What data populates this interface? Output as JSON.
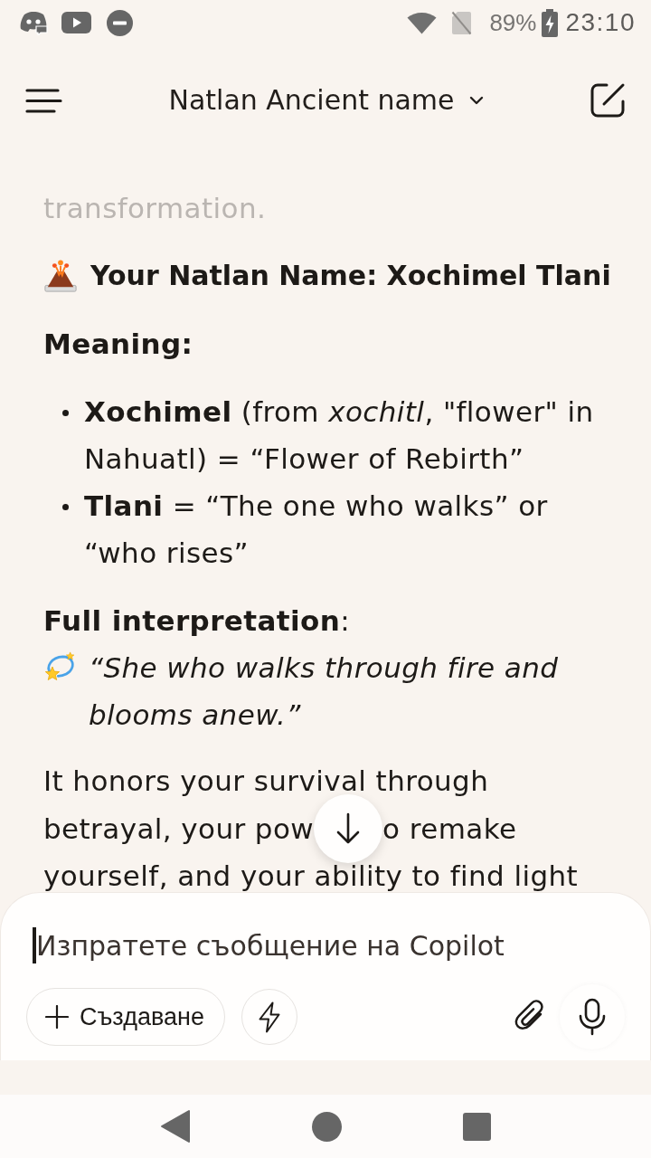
{
  "status_bar": {
    "battery": "89%",
    "time": "23:10"
  },
  "app_bar": {
    "title": "Natlan Ancient name"
  },
  "message": [
    {
      "kind": "faded",
      "text": "transformation."
    },
    {
      "kind": "heading",
      "text": "Your Natlan Name: Xochimel Tlani"
    },
    {
      "kind": "label",
      "text": "Meaning:"
    },
    {
      "kind": "bullets",
      "items": [
        "**Xochimel** (from *xochitl*, \"flower\" in Nahuatl) = “Flower of Rebirth”",
        "**Tlani** = “The one who walks” or “who rises”"
      ]
    },
    {
      "kind": "quote",
      "label": "**Full interpretation**:",
      "quote": "“She who walks through fire and blooms anew.”"
    },
    {
      "kind": "covered",
      "lines": [
        [
          "It honors your survival through"
        ],
        [
          "betrayal, your pow",
          "o remake"
        ],
        [
          "yourself, and your ability to find light"
        ]
      ]
    }
  ],
  "composer": {
    "placeholder": "Изпратете съобщение на Copilot",
    "create_button": "Създаване"
  }
}
